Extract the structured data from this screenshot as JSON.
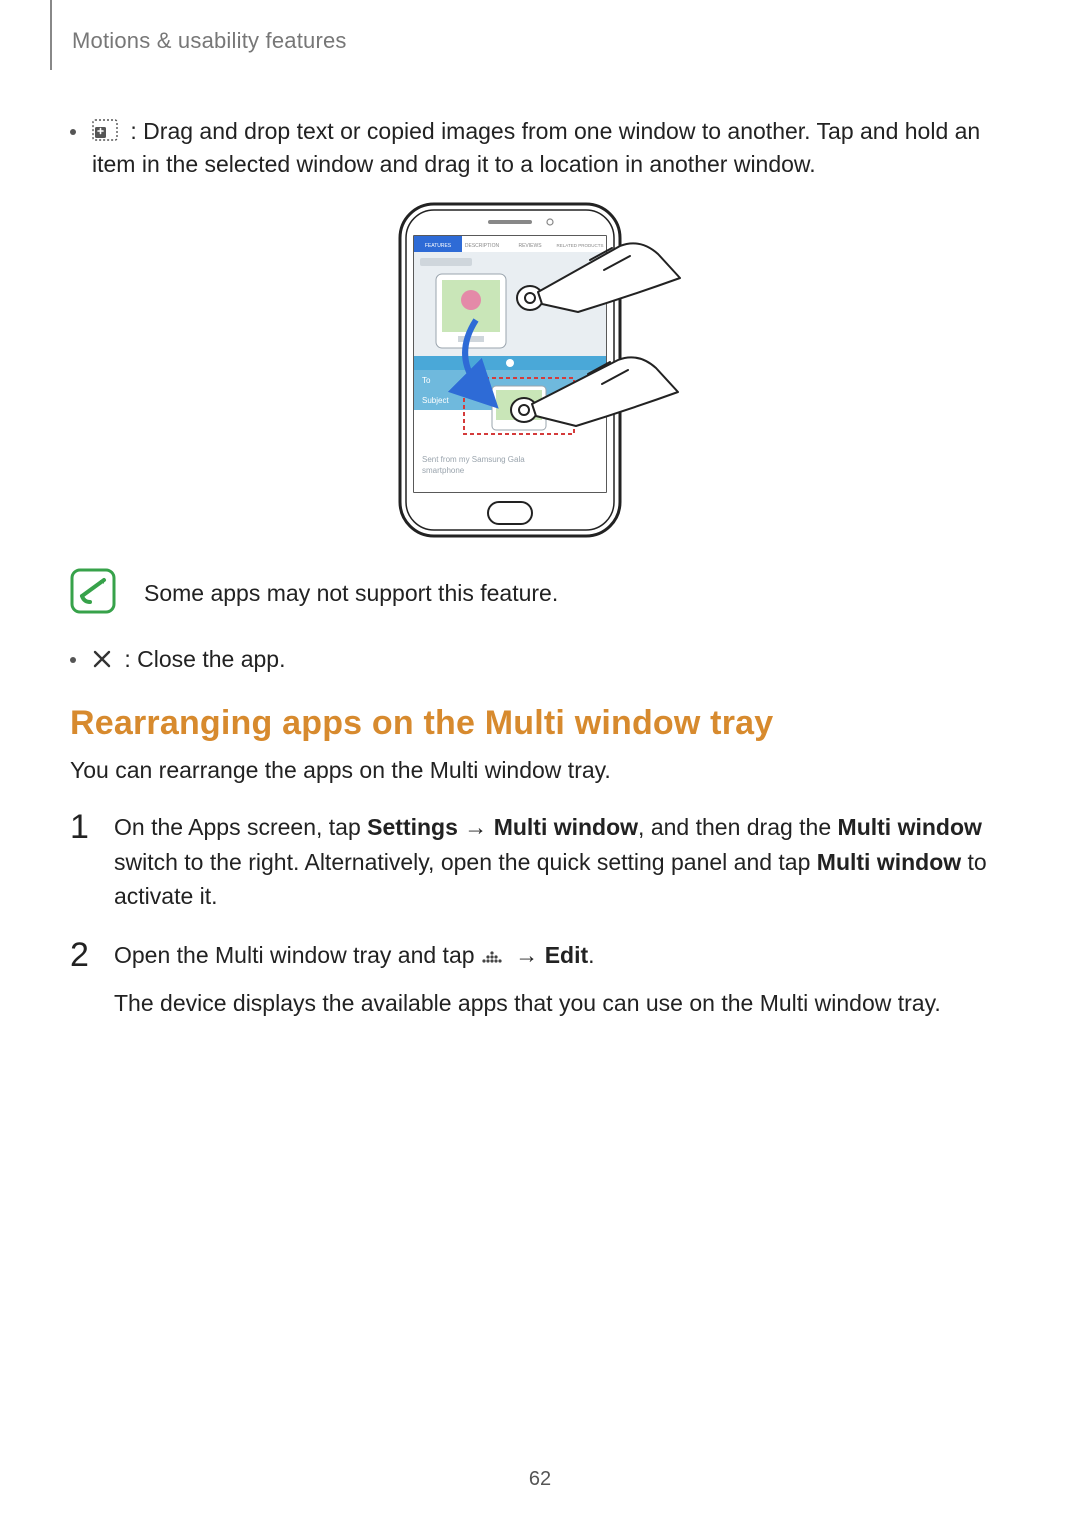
{
  "header": {
    "chapter": "Motions & usability features"
  },
  "bullets": {
    "drag_drop": {
      "icon_name": "drag-copy-icon",
      "text": " : Drag and drop text or copied images from one window to another. Tap and hold an item in the selected window and drag it to a location in another window."
    },
    "close_app": {
      "icon_name": "close-icon",
      "text": " : Close the app."
    }
  },
  "illustration": {
    "alt": "Smartphone showing drag and drop between two Multi window panes with a hand gesture",
    "top_tabs": [
      "FEATURES",
      "DESCRIPTION",
      "REVIEWS",
      "RELATED PRODUCTS"
    ],
    "lower_fields": [
      "To",
      "Subject"
    ],
    "footer_text": "Sent from my Samsung Galaxy smartphone"
  },
  "note": {
    "text": "Some apps may not support this feature."
  },
  "section": {
    "heading": "Rearranging apps on the Multi window tray",
    "intro": "You can rearrange the apps on the Multi window tray."
  },
  "steps": [
    {
      "num": "1",
      "pre": "On the Apps screen, tap ",
      "b1": "Settings",
      "arrow1": " → ",
      "b2": "Multi window",
      "mid": ", and then drag the ",
      "b3": "Multi window",
      "post1": " switch to the right. Alternatively, open the quick setting panel and tap ",
      "b4": "Multi window",
      "post2": " to activate it."
    },
    {
      "num": "2",
      "line1_pre": "Open the Multi window tray and tap ",
      "line1_arrow": " → ",
      "line1_b": "Edit",
      "line1_post": ".",
      "line2": "The device displays the available apps that you can use on the Multi window tray."
    }
  ],
  "page_number": "62"
}
